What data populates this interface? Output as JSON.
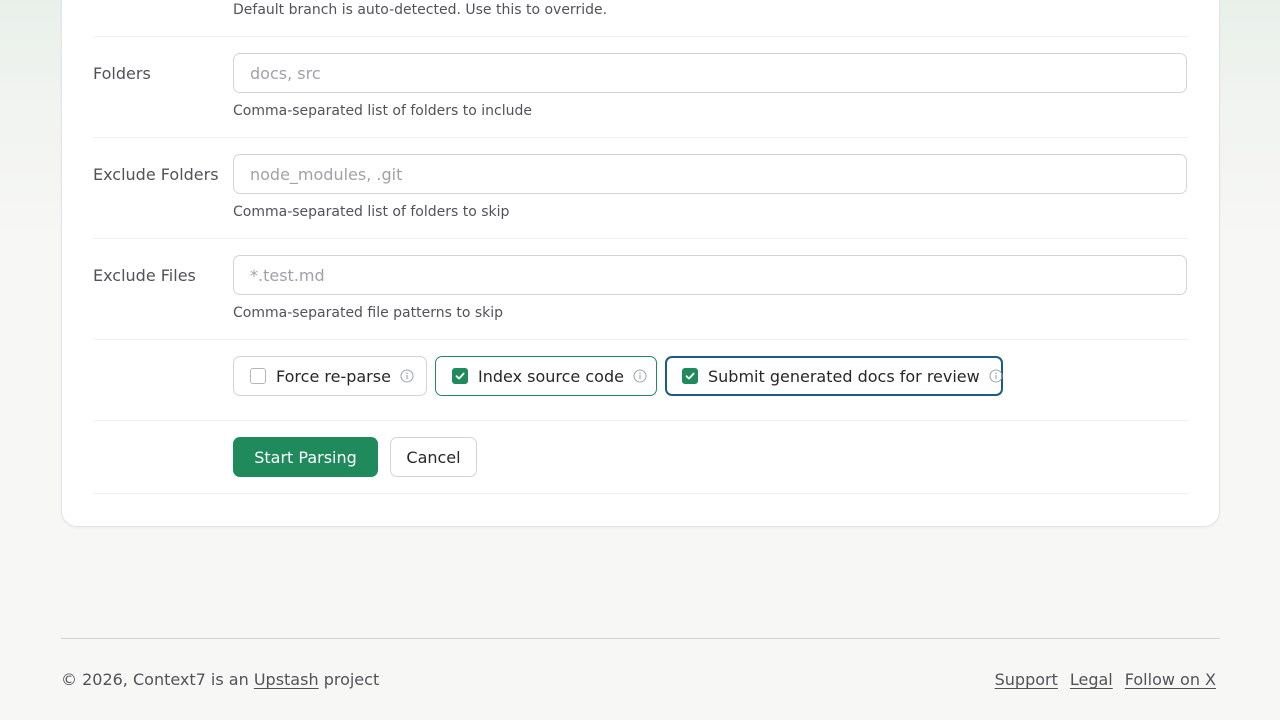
{
  "branch": {
    "hint": "Default branch is auto-detected. Use this to override."
  },
  "folders": {
    "label": "Folders",
    "placeholder": "docs, src",
    "value": "",
    "hint": "Comma-separated list of folders to include"
  },
  "exclude_folders": {
    "label": "Exclude Folders",
    "placeholder": "node_modules, .git",
    "value": "",
    "hint": "Comma-separated list of folders to skip"
  },
  "exclude_files": {
    "label": "Exclude Files",
    "placeholder": "*.test.md",
    "value": "",
    "hint": "Comma-separated file patterns to skip"
  },
  "options": [
    {
      "label": "Force re-parse",
      "checked": false,
      "icon": "info-icon"
    },
    {
      "label": "Index source code",
      "checked": true,
      "icon": "info-icon"
    },
    {
      "label": "Submit generated docs for review",
      "checked": true,
      "icon": "info-icon"
    }
  ],
  "actions": {
    "start_label": "Start Parsing",
    "cancel_label": "Cancel"
  },
  "footer": {
    "copyright_prefix": "© 2026, Context7 is an",
    "brand_link": "Upstash",
    "copyright_suffix": "project",
    "links": [
      "Support",
      "Legal",
      "Follow on X"
    ]
  },
  "colors": {
    "accent": "#1f8a5c",
    "focus_ring": "#1d5a8a"
  }
}
